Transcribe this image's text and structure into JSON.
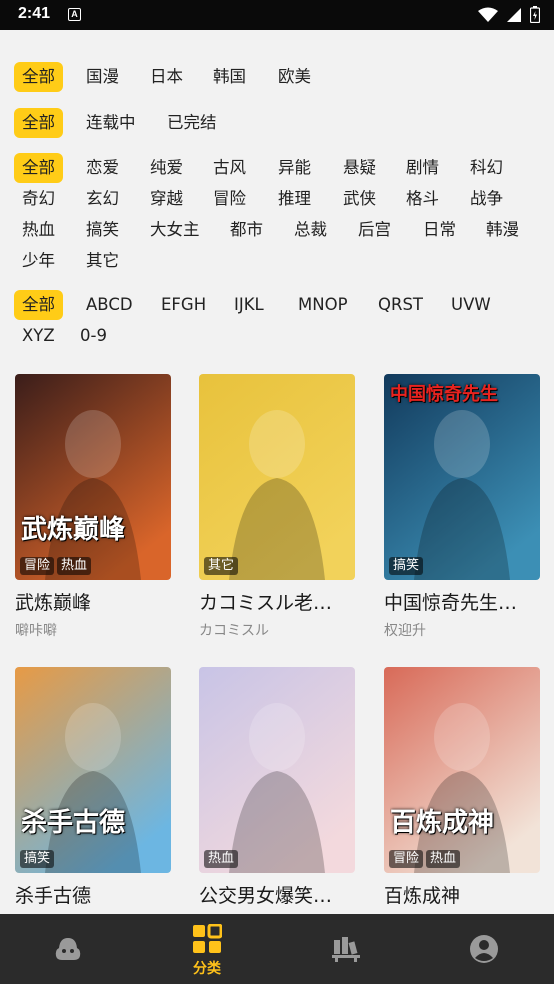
{
  "status_bar": {
    "time": "2:41",
    "notification_badge": "A"
  },
  "filters": {
    "region": {
      "items": [
        "全部",
        "国漫",
        "日本",
        "韩国",
        "欧美"
      ],
      "selected": "全部"
    },
    "status": {
      "items": [
        "全部",
        "连载中",
        "已完结"
      ],
      "selected": "全部"
    },
    "genre": {
      "items": [
        "全部",
        "恋爱",
        "纯爱",
        "古风",
        "异能",
        "悬疑",
        "剧情",
        "科幻",
        "奇幻",
        "玄幻",
        "穿越",
        "冒险",
        "推理",
        "武侠",
        "格斗",
        "战争",
        "热血",
        "搞笑",
        "大女主",
        "都市",
        "总裁",
        "后宫",
        "日常",
        "韩漫",
        "少年",
        "其它"
      ],
      "selected": "全部"
    },
    "letter": {
      "items": [
        "全部",
        "ABCD",
        "EFGH",
        "IJKL",
        "MNOP",
        "QRST",
        "UVW",
        "XYZ",
        "0-9"
      ],
      "selected": "全部"
    }
  },
  "comics": [
    {
      "title": "武炼巅峰",
      "author": "噼咔噼",
      "tags": [
        "冒险",
        "热血"
      ],
      "cover_text": "武炼巅峰",
      "cover_colors": [
        "#3a1d1a",
        "#d9652a"
      ]
    },
    {
      "title": "カコミスル老…",
      "author": "カコミスル",
      "tags": [
        "其它"
      ],
      "cover_text": "",
      "cover_colors": [
        "#e8c23c",
        "#f2d25a"
      ]
    },
    {
      "title": "中国惊奇先生…",
      "author": "权迎升",
      "tags": [
        "搞笑"
      ],
      "cover_text": "中国惊奇先生",
      "cover_colors": [
        "#123a5c",
        "#3c8fb5"
      ]
    },
    {
      "title": "杀手古德",
      "author": "",
      "tags": [
        "搞笑"
      ],
      "cover_text": "杀手古德",
      "cover_colors": [
        "#e79a45",
        "#6cb6e2"
      ]
    },
    {
      "title": "公交男女爆笑…",
      "author": "",
      "tags": [
        "热血"
      ],
      "cover_text": "",
      "cover_colors": [
        "#c8c4e6",
        "#f3d9dd"
      ]
    },
    {
      "title": "百炼成神",
      "author": "",
      "tags": [
        "冒险",
        "热血"
      ],
      "cover_text": "百炼成神",
      "cover_colors": [
        "#d86a58",
        "#f2e3d8"
      ]
    }
  ],
  "bottom_nav": [
    {
      "icon": "home-icon",
      "label": ""
    },
    {
      "icon": "category-grid-icon",
      "label": "分类",
      "active": true
    },
    {
      "icon": "bookshelf-icon",
      "label": ""
    },
    {
      "icon": "profile-icon",
      "label": ""
    }
  ],
  "colors": {
    "accent": "#ffcc17",
    "nav_bg": "#2b2b2b",
    "page_bg": "#f2f2f2"
  }
}
